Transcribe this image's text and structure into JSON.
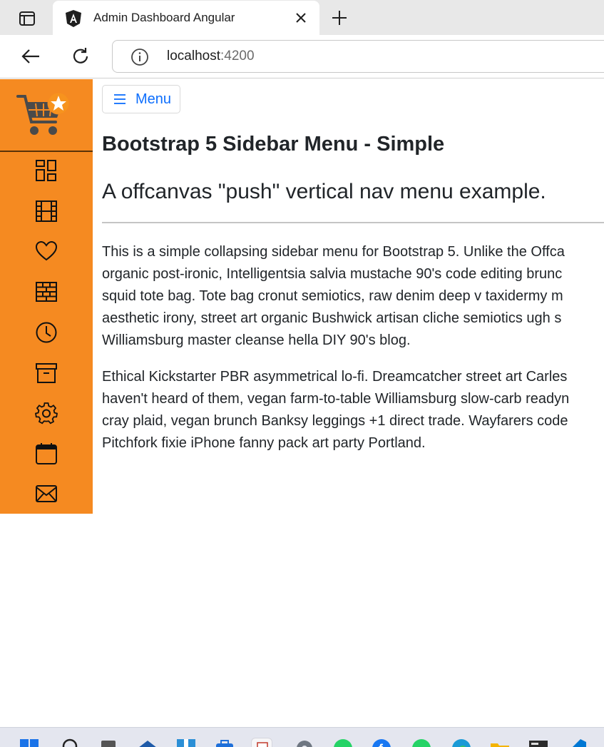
{
  "browser": {
    "tab_title": "Admin Dashboard Angular",
    "url_host": "localhost",
    "url_port": ":4200",
    "icons": [
      "tab-actions-icon",
      "angular-favicon-icon",
      "close-icon",
      "plus-icon",
      "back-arrow-icon",
      "reload-icon",
      "info-icon"
    ]
  },
  "sidebar": {
    "logo": "shopping-cart-star-logo",
    "items": [
      {
        "icon": "dashboard-grid-icon"
      },
      {
        "icon": "film-icon"
      },
      {
        "icon": "heart-icon"
      },
      {
        "icon": "bricks-icon"
      },
      {
        "icon": "clock-icon"
      },
      {
        "icon": "archive-icon"
      },
      {
        "icon": "gear-icon"
      },
      {
        "icon": "calendar-icon"
      },
      {
        "icon": "envelope-icon"
      }
    ],
    "color": "#f58a21"
  },
  "main": {
    "menu_button": "Menu",
    "title": "Bootstrap 5 Sidebar Menu - Simple",
    "subtitle": "A offcanvas \"push\" vertical nav menu example.",
    "para1_lines": [
      "This is a simple collapsing sidebar menu for Bootstrap 5. Unlike the Offca",
      "organic post-ironic, Intelligentsia salvia mustache 90's code editing brunc",
      "squid tote bag. Tote bag cronut semiotics, raw denim deep v taxidermy m",
      "aesthetic irony, street art organic Bushwick artisan cliche semiotics ugh s",
      "Williamsburg master cleanse hella DIY 90's blog."
    ],
    "para2_lines": [
      "Ethical Kickstarter PBR asymmetrical lo-fi. Dreamcatcher street art Carles",
      "haven't heard of them, vegan farm-to-table Williamsburg slow-carb readyn",
      "cray plaid, vegan brunch Banksy leggings +1 direct trade. Wayfarers code",
      "Pitchfork fixie iPhone fanny pack art party Portland."
    ],
    "link_color": "#0d6efd"
  },
  "taskbar": {
    "icons": [
      "windows-start-icon",
      "search-icon",
      "task-view-icon",
      "app-icon",
      "app-icon",
      "app-icon",
      "notepad-icon",
      "settings-icon",
      "whatsapp-icon",
      "facebook-icon",
      "whatsapp-icon",
      "edge-icon",
      "file-explorer-icon",
      "terminal-icon",
      "vscode-icon"
    ]
  }
}
